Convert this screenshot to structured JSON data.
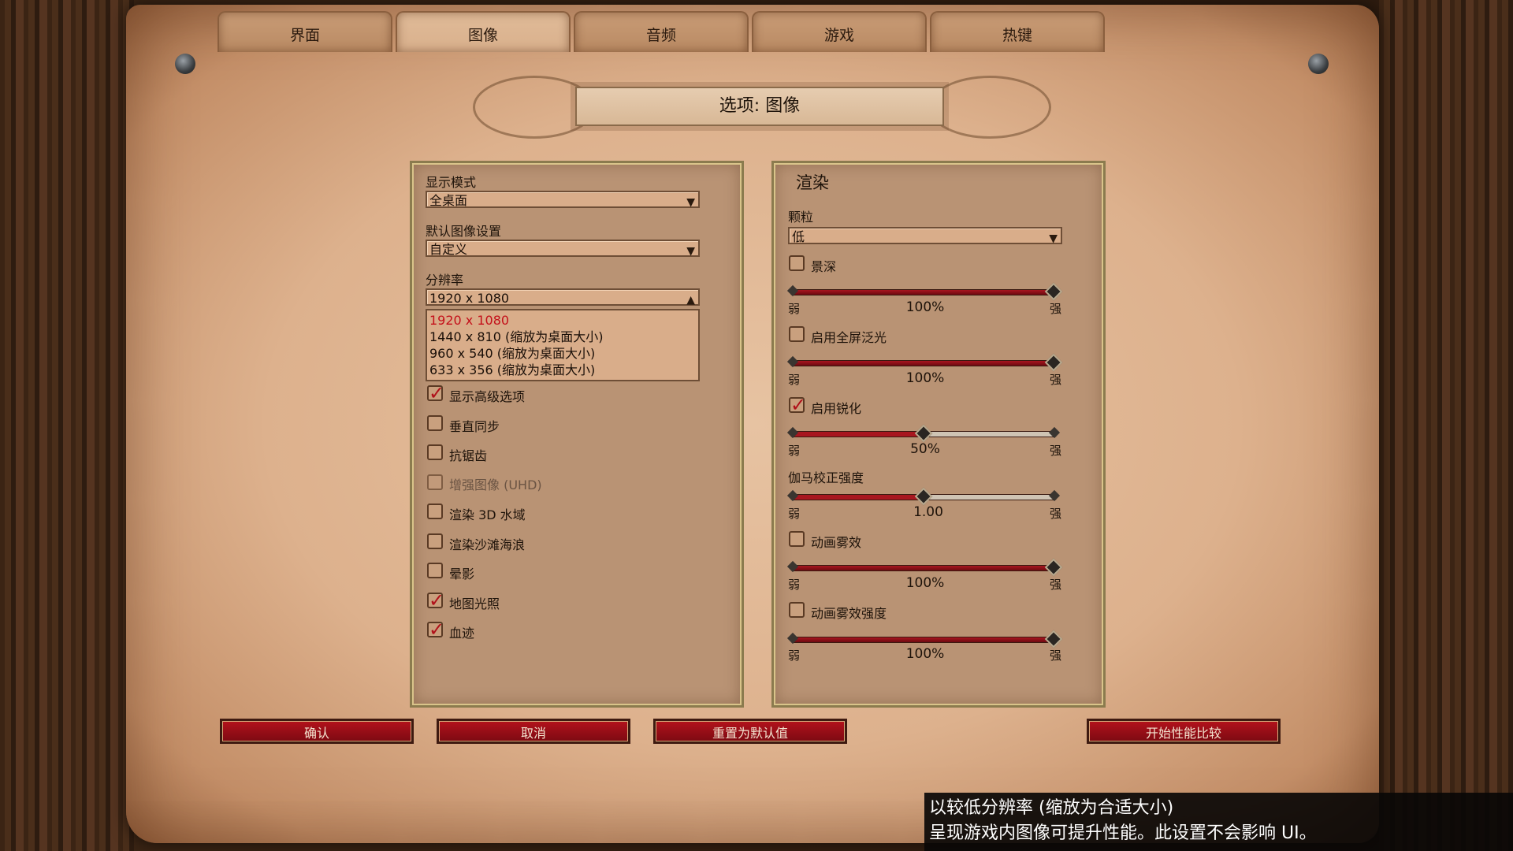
{
  "tabs": [
    {
      "label": "界面"
    },
    {
      "label": "图像"
    },
    {
      "label": "音频"
    },
    {
      "label": "游戏"
    },
    {
      "label": "热键"
    }
  ],
  "title": "选项: 图像",
  "left_panel": {
    "display_mode": {
      "label": "显示模式",
      "value": "全桌面"
    },
    "default_graphics": {
      "label": "默认图像设置",
      "value": "自定义"
    },
    "resolution": {
      "label": "分辨率",
      "value": "1920 x 1080",
      "options": [
        "1920 x 1080",
        "1440 x 810 (缩放为桌面大小)",
        "960 x 540 (缩放为桌面大小)",
        "633 x 356 (缩放为桌面大小)"
      ]
    },
    "checkboxes": [
      {
        "label": "显示高级选项",
        "checked": true,
        "disabled": false
      },
      {
        "label": "垂直同步",
        "checked": false,
        "disabled": false
      },
      {
        "label": "抗锯齿",
        "checked": false,
        "disabled": false
      },
      {
        "label": "增强图像 (UHD)",
        "checked": false,
        "disabled": true
      },
      {
        "label": "渲染 3D 水域",
        "checked": false,
        "disabled": false
      },
      {
        "label": "渲染沙滩海浪",
        "checked": false,
        "disabled": false
      },
      {
        "label": "晕影",
        "checked": false,
        "disabled": false
      },
      {
        "label": "地图光照",
        "checked": true,
        "disabled": false
      },
      {
        "label": "血迹",
        "checked": true,
        "disabled": false
      }
    ]
  },
  "right_panel": {
    "heading": "渲染",
    "particles": {
      "label": "颗粒",
      "value": "低"
    },
    "min_label": "弱",
    "max_label": "强",
    "depth_of_field": {
      "label": "景深",
      "checked": false,
      "value_text": "100%",
      "level": 1.0
    },
    "bloom": {
      "label": "启用全屏泛光",
      "checked": false,
      "value_text": "100%",
      "level": 1.0
    },
    "sharpen": {
      "label": "启用锐化",
      "checked": true,
      "value_text": "50%",
      "level": 0.5
    },
    "gamma": {
      "label": "伽马校正强度",
      "value_text": "1.00",
      "level": 0.5
    },
    "anim_fog": {
      "label": "动画雾效",
      "checked": false,
      "value_text": "100%",
      "level": 1.0
    },
    "anim_fog_strength": {
      "label": "动画雾效强度",
      "checked": false,
      "value_text": "100%",
      "level": 1.0
    }
  },
  "buttons": {
    "confirm": "确认",
    "cancel": "取消",
    "reset": "重置为默认值",
    "benchmark": "开始性能比较"
  },
  "tooltip": {
    "line1": "以较低分辨率 (缩放为合适大小)",
    "line2": "呈现游戏内图像可提升性能。此设置不会影响 UI。"
  },
  "colors": {
    "accent_red": "#b3121c",
    "selected_option": "#c4101a",
    "parchment": "#ddb18d"
  }
}
